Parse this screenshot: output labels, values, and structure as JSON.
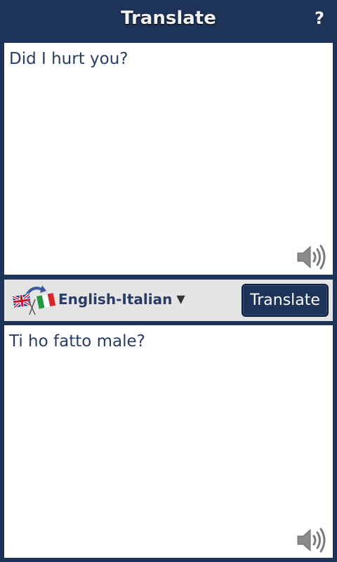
{
  "header": {
    "title": "Translate",
    "help_label": "?"
  },
  "source": {
    "text": "Did I hurt you?",
    "speaker_icon": "speaker-icon"
  },
  "language_bar": {
    "flags_icon": "english-italian-flags-icon",
    "language_pair": "English-Italian",
    "dropdown_arrow": "▼",
    "translate_label": "Translate"
  },
  "target": {
    "text": "Ti ho fatto male?",
    "speaker_icon": "speaker-icon"
  },
  "colors": {
    "header_bg": "#1e3358",
    "text": "#283c64",
    "bar_bg": "#e4e4e4",
    "button_bg": "#1e3358"
  }
}
